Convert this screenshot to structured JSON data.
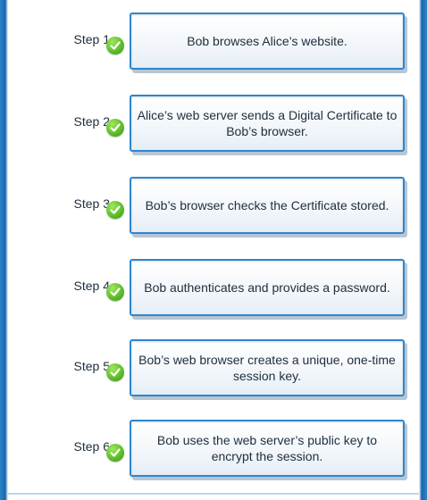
{
  "steps": [
    {
      "label": "Step 1",
      "text": "Bob browses Alice’s website."
    },
    {
      "label": "Step 2",
      "text": "Alice’s web server sends a Digital Certificate to Bob’s browser."
    },
    {
      "label": "Step 3",
      "text": "Bob’s browser checks the Certificate stored."
    },
    {
      "label": "Step 4",
      "text": "Bob authenticates and provides a password."
    },
    {
      "label": "Step 5",
      "text": "Bob’s web browser creates a unique, one-time session key."
    },
    {
      "label": "Step 6",
      "text": "Bob uses the web server’s public key to encrypt the session."
    }
  ],
  "colors": {
    "frame": "#1f6fb4",
    "box_border": "#2e86cf",
    "check": "#5fbf2a"
  },
  "icons": {
    "status": "checkmark-circle-icon"
  }
}
